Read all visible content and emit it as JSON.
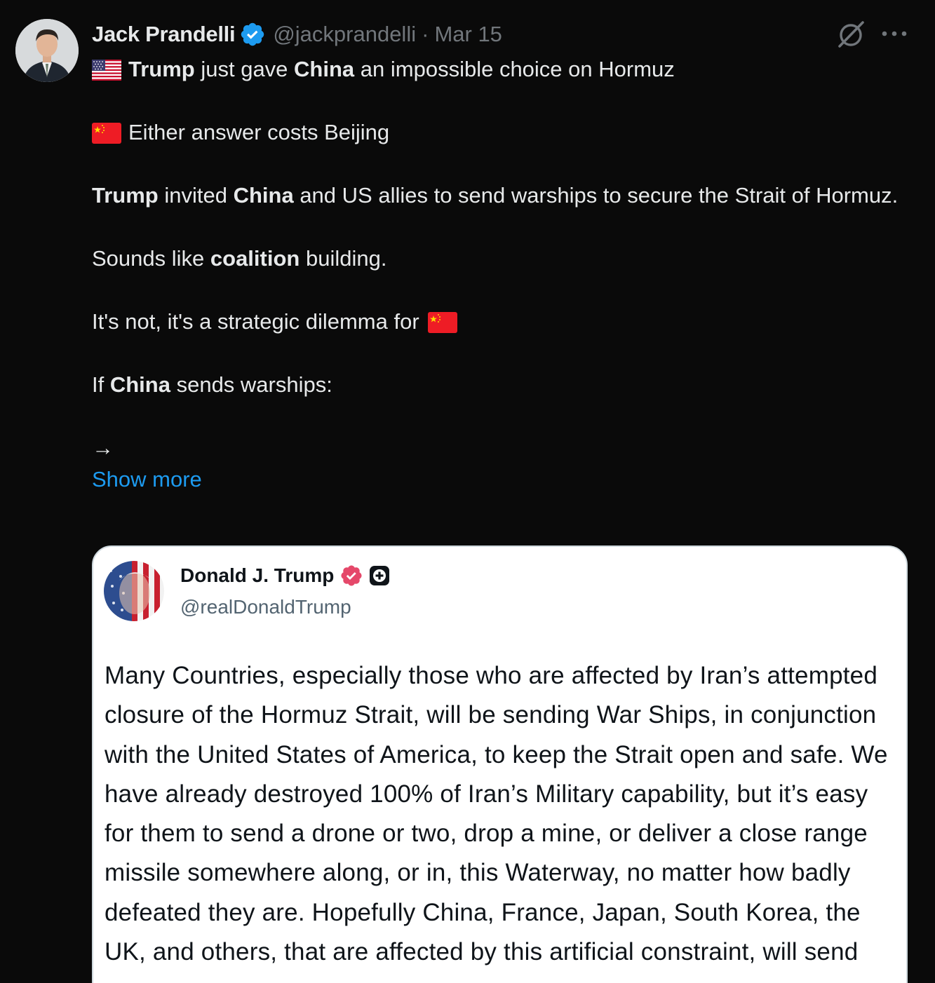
{
  "post": {
    "author_name": "Jack Prandelli",
    "handle": "@jackprandelli",
    "separator": "·",
    "date": "Mar 15",
    "line1": {
      "pre": "",
      "b1": "Trump",
      "mid": " just gave ",
      "b2": "China",
      "post": " an impossible choice on Hormuz"
    },
    "line2": "Either answer costs Beijing",
    "line3": {
      "b1": "Trump",
      "mid": " invited ",
      "b2": "China",
      "post": " and US allies to send warships to secure the Strait of Hormuz."
    },
    "line4": {
      "pre": "Sounds like ",
      "b1": "coalition",
      "post": " building."
    },
    "line5": "It's not, it's a strategic dilemma for",
    "line6": {
      "pre": "If ",
      "b1": "China",
      "post": " sends warships:"
    },
    "arrow": "→",
    "show_more": "Show more"
  },
  "quote": {
    "author_name": "Donald J. Trump",
    "handle": "@realDonaldTrump",
    "text": "Many Countries, especially those who are affected by Iran’s attempted closure of the Hormuz Strait, will be sending War Ships, in conjunction with the United States of America, to keep the Strait open and safe. We have already destroyed 100% of Iran’s Military capability, but it’s easy for them to send a drone or two, drop a mine, or deliver a close range missile somewhere along, or in, this Waterway, no matter how badly defeated they are. Hopefully China, France, Japan, South Korea, the UK, and others, that are affected by this artificial constraint, will send"
  },
  "icons": {
    "verified": "verified-badge-icon",
    "grok": "grok-icon",
    "more": "more-options-icon",
    "flag_us": "us-flag-icon",
    "flag_cn": "china-flag-icon"
  },
  "colors": {
    "background": "#0a0a0a",
    "text": "#e7e9ea",
    "muted": "#71767b",
    "link": "#1d9bf0",
    "verified": "#1d9bf0"
  }
}
